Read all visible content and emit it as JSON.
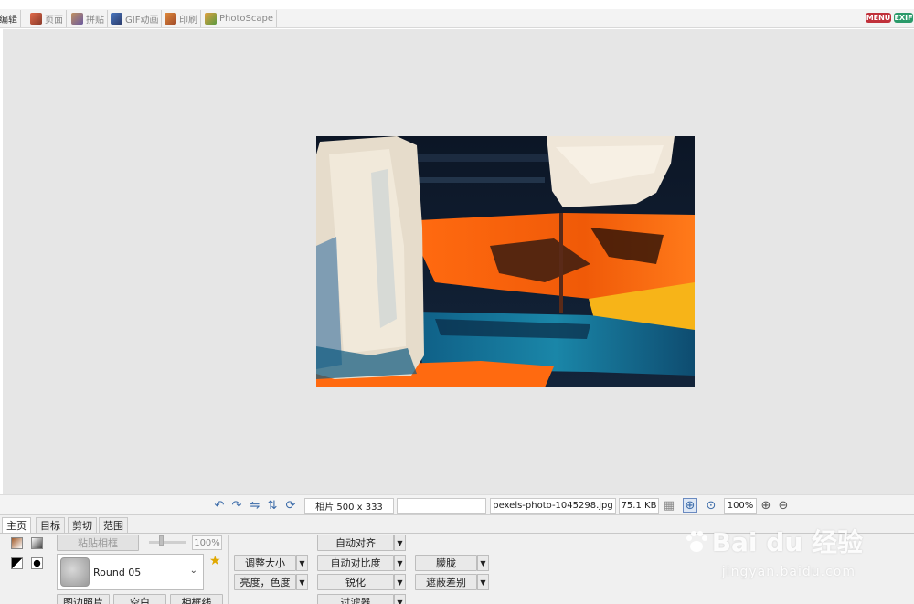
{
  "top_tabs": [
    {
      "label": "编辑",
      "icon": "edit-icon",
      "color": "#c06040"
    },
    {
      "label": "页面",
      "icon": "page-icon",
      "color": "#d04040"
    },
    {
      "label": "拼贴",
      "icon": "collage-icon",
      "color": "#b08050"
    },
    {
      "label": "GIF动画",
      "icon": "gif-icon",
      "color": "#4a78c0"
    },
    {
      "label": "印刷",
      "icon": "print-icon",
      "color": "#d07030"
    },
    {
      "label": "PhotoScape",
      "icon": "photoscape-icon",
      "color": "#6a9a40"
    }
  ],
  "badges": {
    "menu": "MENU",
    "exif": "EXIF",
    "menu_color": "#c0303a",
    "exif_color": "#2a9a6a"
  },
  "status": {
    "dimensions": "相片 500 x 333",
    "filename": "pexels-photo-1045298.jpg",
    "filesize": "75.1 KB",
    "zoom": "100%"
  },
  "panel": {
    "tabs": [
      "主页",
      "目标",
      "剪切",
      "范围"
    ],
    "paste_frame": "粘贴相框",
    "opacity": "100%",
    "frame_name": "Round 05",
    "frame_photo": "图边照片",
    "blank": "空白",
    "frame_line": "相框线",
    "resize": "调整大小",
    "brightness": "亮度，色度",
    "auto_level": "自动对齐",
    "auto_contrast": "自动对比度",
    "sharpen": "锐化",
    "filter": "过滤器",
    "backlight": "朦胧",
    "vignette": "遮蔽差别"
  },
  "watermark": {
    "brand": "Bai du 经验",
    "url": "jingyan.baidu.com"
  }
}
